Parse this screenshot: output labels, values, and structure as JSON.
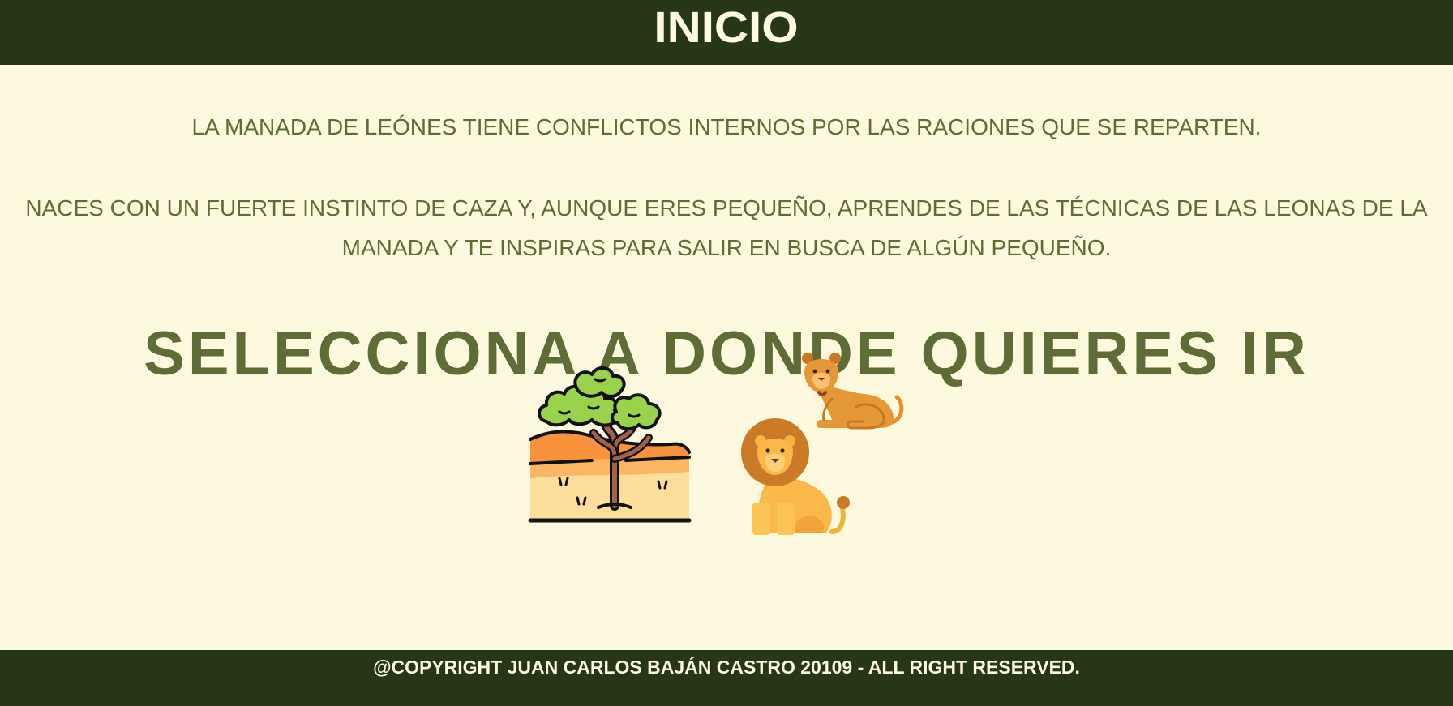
{
  "header": {
    "title": "INICIO"
  },
  "main": {
    "paragraph_1": "LA MANADA DE LEÓNES TIENE CONFLICTOS INTERNOS POR LAS RACIONES QUE SE REPARTEN.",
    "paragraph_2": "NACES CON UN FUERTE INSTINTO DE CAZA Y, AUNQUE ERES PEQUEÑO, APRENDES DE LAS TÉCNICAS DE LAS LEONAS DE LA MANADA Y TE INSPIRAS PARA SALIR EN BUSCA DE ALGÚN PEQUEÑO.",
    "prompt": "SELECCIONA A DONDE QUIERES IR",
    "choices": [
      {
        "icon": "savanna-tree-icon"
      },
      {
        "icon": "lioness-icon"
      },
      {
        "icon": "lion-icon"
      }
    ]
  },
  "footer": {
    "copyright": "@COPYRIGHT JUAN CARLOS BAJÁN CASTRO 20109 - ALL RIGHT RESERVED."
  },
  "colors": {
    "header_bg": "#283618",
    "page_bg": "#fdf9de",
    "text_olive": "#606c38",
    "light_text": "#fefae0"
  }
}
